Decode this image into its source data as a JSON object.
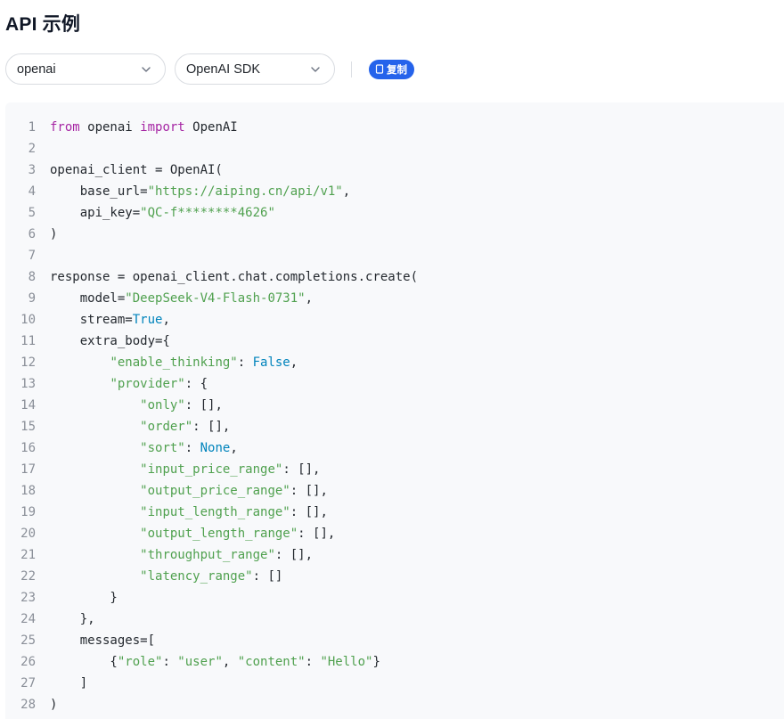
{
  "header": {
    "title": "API 示例"
  },
  "controls": {
    "client_select": "openai",
    "sdk_select": "OpenAI SDK",
    "copy_label": "复制"
  },
  "icons": {
    "chevron": "chevron-down-icon",
    "copy": "copy-icon"
  },
  "colors": {
    "accent": "#2563eb",
    "keyword": "#a626a4",
    "string": "#50a14f",
    "constant": "#0184bc",
    "code_background": "#f8f9fb"
  },
  "code": {
    "language": "python",
    "lines": [
      [
        {
          "t": "kw",
          "v": "from"
        },
        {
          "t": "plain",
          "v": " openai "
        },
        {
          "t": "kw",
          "v": "import"
        },
        {
          "t": "plain",
          "v": " OpenAI"
        }
      ],
      [],
      [
        {
          "t": "plain",
          "v": "openai_client = OpenAI("
        }
      ],
      [
        {
          "t": "plain",
          "v": "    base_url="
        },
        {
          "t": "str",
          "v": "\"https://aiping.cn/api/v1\""
        },
        {
          "t": "plain",
          "v": ","
        }
      ],
      [
        {
          "t": "plain",
          "v": "    api_key="
        },
        {
          "t": "str",
          "v": "\"QC-f********4626\""
        }
      ],
      [
        {
          "t": "plain",
          "v": ")"
        }
      ],
      [],
      [
        {
          "t": "plain",
          "v": "response = openai_client.chat.completions.create("
        }
      ],
      [
        {
          "t": "plain",
          "v": "    model="
        },
        {
          "t": "str",
          "v": "\"DeepSeek-V4-Flash-0731\""
        },
        {
          "t": "plain",
          "v": ","
        }
      ],
      [
        {
          "t": "plain",
          "v": "    stream="
        },
        {
          "t": "const",
          "v": "True"
        },
        {
          "t": "plain",
          "v": ","
        }
      ],
      [
        {
          "t": "plain",
          "v": "    extra_body={"
        }
      ],
      [
        {
          "t": "plain",
          "v": "        "
        },
        {
          "t": "str",
          "v": "\"enable_thinking\""
        },
        {
          "t": "plain",
          "v": ": "
        },
        {
          "t": "const",
          "v": "False"
        },
        {
          "t": "plain",
          "v": ","
        }
      ],
      [
        {
          "t": "plain",
          "v": "        "
        },
        {
          "t": "str",
          "v": "\"provider\""
        },
        {
          "t": "plain",
          "v": ": {"
        }
      ],
      [
        {
          "t": "plain",
          "v": "            "
        },
        {
          "t": "str",
          "v": "\"only\""
        },
        {
          "t": "plain",
          "v": ": [],"
        }
      ],
      [
        {
          "t": "plain",
          "v": "            "
        },
        {
          "t": "str",
          "v": "\"order\""
        },
        {
          "t": "plain",
          "v": ": [],"
        }
      ],
      [
        {
          "t": "plain",
          "v": "            "
        },
        {
          "t": "str",
          "v": "\"sort\""
        },
        {
          "t": "plain",
          "v": ": "
        },
        {
          "t": "const",
          "v": "None"
        },
        {
          "t": "plain",
          "v": ","
        }
      ],
      [
        {
          "t": "plain",
          "v": "            "
        },
        {
          "t": "str",
          "v": "\"input_price_range\""
        },
        {
          "t": "plain",
          "v": ": [],"
        }
      ],
      [
        {
          "t": "plain",
          "v": "            "
        },
        {
          "t": "str",
          "v": "\"output_price_range\""
        },
        {
          "t": "plain",
          "v": ": [],"
        }
      ],
      [
        {
          "t": "plain",
          "v": "            "
        },
        {
          "t": "str",
          "v": "\"input_length_range\""
        },
        {
          "t": "plain",
          "v": ": [],"
        }
      ],
      [
        {
          "t": "plain",
          "v": "            "
        },
        {
          "t": "str",
          "v": "\"output_length_range\""
        },
        {
          "t": "plain",
          "v": ": [],"
        }
      ],
      [
        {
          "t": "plain",
          "v": "            "
        },
        {
          "t": "str",
          "v": "\"throughput_range\""
        },
        {
          "t": "plain",
          "v": ": [],"
        }
      ],
      [
        {
          "t": "plain",
          "v": "            "
        },
        {
          "t": "str",
          "v": "\"latency_range\""
        },
        {
          "t": "plain",
          "v": ": []"
        }
      ],
      [
        {
          "t": "plain",
          "v": "        }"
        }
      ],
      [
        {
          "t": "plain",
          "v": "    },"
        }
      ],
      [
        {
          "t": "plain",
          "v": "    messages=["
        }
      ],
      [
        {
          "t": "plain",
          "v": "        {"
        },
        {
          "t": "str",
          "v": "\"role\""
        },
        {
          "t": "plain",
          "v": ": "
        },
        {
          "t": "str",
          "v": "\"user\""
        },
        {
          "t": "plain",
          "v": ", "
        },
        {
          "t": "str",
          "v": "\"content\""
        },
        {
          "t": "plain",
          "v": ": "
        },
        {
          "t": "str",
          "v": "\"Hello\""
        },
        {
          "t": "plain",
          "v": "}"
        }
      ],
      [
        {
          "t": "plain",
          "v": "    ]"
        }
      ],
      [
        {
          "t": "plain",
          "v": ")"
        }
      ]
    ]
  }
}
